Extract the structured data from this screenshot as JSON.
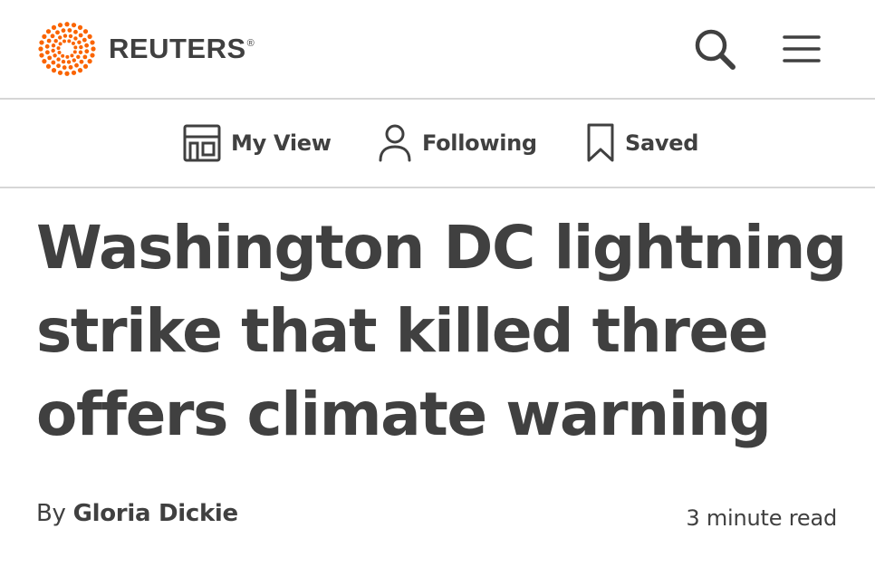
{
  "header": {
    "logo_text": "REUTERS",
    "logo_registered": "®",
    "brand_color": "#fa6400",
    "icons": [
      "reuters-logo-icon",
      "search-icon",
      "hamburger-menu-icon"
    ]
  },
  "nav": {
    "items": [
      {
        "label": "My View",
        "icon": "layout-icon"
      },
      {
        "label": "Following",
        "icon": "person-icon"
      },
      {
        "label": "Saved",
        "icon": "bookmark-icon"
      }
    ]
  },
  "article": {
    "headline": "Washington DC lightning strike that killed three offers climate warning",
    "byline_prefix": "By ",
    "author": "Gloria Dickie",
    "read_time": "3 minute read"
  },
  "colors": {
    "text": "#404040",
    "divider": "#d6d6d6",
    "brand": "#fa6400"
  }
}
